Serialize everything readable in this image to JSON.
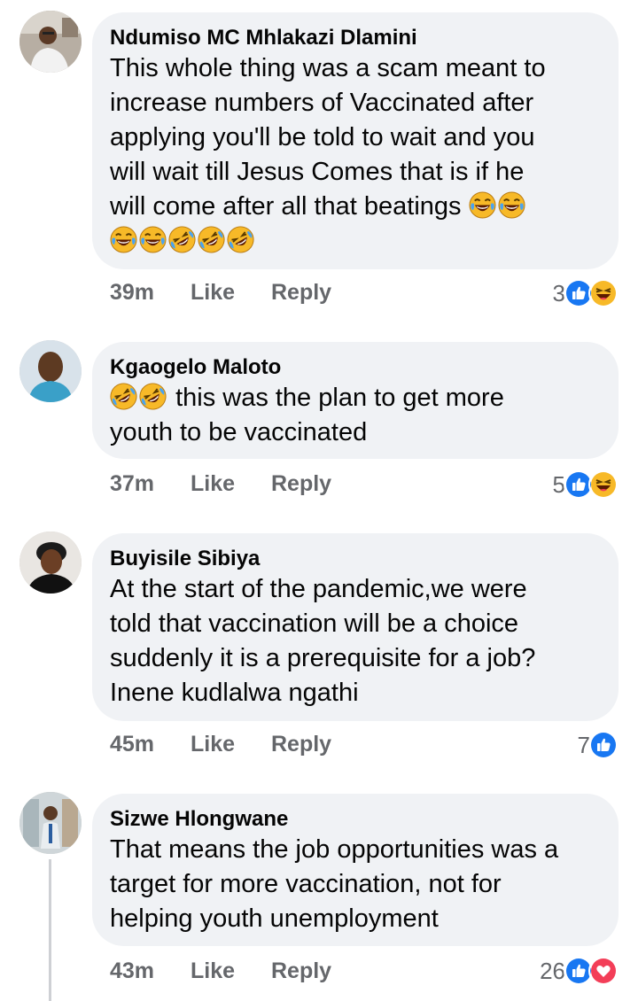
{
  "comments": [
    {
      "author": "Ndumiso MC Mhlakazi Dlamini",
      "text_lines": [
        "This whole thing was a scam meant to",
        "increase numbers of Vaccinated after",
        "applying you'll be told to wait and you",
        "will wait till Jesus Comes  that is if he",
        "will come after all that beatings"
      ],
      "time": "39m",
      "like_label": "Like",
      "reply_label": "Reply",
      "reaction_count": "3",
      "reactions": [
        "like-icon",
        "haha-icon"
      ]
    },
    {
      "author": "Kgaogelo Maloto",
      "text_lines": [
        "this was the plan to get more",
        "youth to be vaccinated"
      ],
      "time": "37m",
      "like_label": "Like",
      "reply_label": "Reply",
      "reaction_count": "5",
      "reactions": [
        "like-icon",
        "haha-icon"
      ]
    },
    {
      "author": "Buyisile Sibiya",
      "text_lines": [
        "At the start of the pandemic,we were",
        "told that vaccination will be a choice",
        "suddenly it is a prerequisite for a job?",
        "Inene kudlalwa ngathi"
      ],
      "time": "45m",
      "like_label": "Like",
      "reply_label": "Reply",
      "reaction_count": "7",
      "reactions": [
        "like-icon"
      ]
    },
    {
      "author": "Sizwe Hlongwane",
      "text_lines": [
        "That means the job opportunities was a",
        "target for more vaccination, not for",
        "helping youth unemployment"
      ],
      "time": "43m",
      "like_label": "Like",
      "reply_label": "Reply",
      "reaction_count": "26",
      "reactions": [
        "like-icon",
        "love-icon"
      ]
    }
  ],
  "colors": {
    "bubble": "#f0f2f5",
    "meta_text": "#65676b",
    "like_blue": "#1877f2",
    "love_red": "#f33e58",
    "haha_yellow": "#f7b928"
  }
}
